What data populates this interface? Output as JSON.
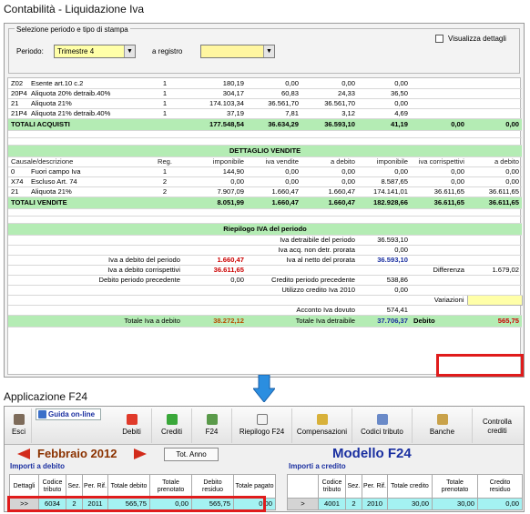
{
  "headings": {
    "top": "Contabilità  - Liquidazione  Iva",
    "bottom": "Applicazione  F24"
  },
  "selection": {
    "legend": "Selezione periodo e tipo di stampa",
    "period_label": "Periodo:",
    "period_value": "Trimestre 4",
    "register_label": "a registro",
    "register_value": "",
    "show_details_label": "Visualizza dettagli"
  },
  "purchases": {
    "rows": [
      [
        "Z02",
        "Esente art.10 c.2",
        "1",
        "180,19",
        "0,00",
        "0,00",
        "0,00"
      ],
      [
        "20P4",
        "Aliquota 20% detraib.40%",
        "1",
        "304,17",
        "60,83",
        "24,33",
        "36,50"
      ],
      [
        "21",
        "Aliquota 21%",
        "1",
        "174.103,34",
        "36.561,70",
        "36.561,70",
        "0,00"
      ],
      [
        "21P4",
        "Aliquota 21% detraib.40%",
        "1",
        "37,19",
        "7,81",
        "3,12",
        "4,69"
      ]
    ],
    "total_label": "TOTALI ACQUISTI",
    "totals": [
      "177.548,54",
      "36.634,29",
      "36.593,10",
      "41,19",
      "0,00",
      "0,00"
    ]
  },
  "sales": {
    "title": "DETTAGLIO VENDITE",
    "columns": [
      "Causale/descrizione",
      "Reg.",
      "imponibile",
      "iva vendite",
      "a debito",
      "imponibile",
      "iva corrispettivi",
      "a debito"
    ],
    "rows": [
      [
        "0",
        "Fuori campo Iva",
        "1",
        "144,90",
        "0,00",
        "0,00",
        "0,00",
        "0,00",
        "0,00"
      ],
      [
        "X74",
        "Escluso Art. 74",
        "2",
        "0,00",
        "0,00",
        "0,00",
        "8.587,65",
        "0,00",
        "0,00"
      ],
      [
        "21",
        "Aliquota 21%",
        "2",
        "7.907,09",
        "1.660,47",
        "1.660,47",
        "174.141,01",
        "36.611,65",
        "36.611,65"
      ]
    ],
    "total_label": "TOTALI VENDITE",
    "totals": [
      "8.051,99",
      "1.660,47",
      "1.660,47",
      "182.928,66",
      "36.611,65",
      "36.611,65"
    ]
  },
  "summary": {
    "title": "Riepilogo IVA del periodo",
    "iva_detraibile_label": "Iva detraibile del periodo",
    "iva_detraibile": "36.593,10",
    "iva_acq_label": "Iva acq. non detr. prorata",
    "iva_acq": "0,00",
    "iva_debito_label": "Iva a debito del periodo",
    "iva_debito": "1.660,47",
    "iva_netto_label": "Iva al netto del prorata",
    "iva_netto": "36.593,10",
    "iva_corr_label": "Iva a debito corrispettivi",
    "iva_corr": "36.611,65",
    "differenza_label": "Differenza",
    "differenza": "1.679,02",
    "debito_prec_label": "Debito periodo precedente",
    "debito_prec": "0,00",
    "credito_prec_label": "Credito periodo precedente",
    "credito_prec": "538,86",
    "utilizzo_label": "Utilizzo credito Iva 2010",
    "utilizzo": "0,00",
    "variazioni_label": "Variazioni",
    "acconto_label": "Acconto Iva dovuto",
    "acconto": "574,41",
    "tot_debito_label": "Totale Iva a debito",
    "tot_debito": "38.272,12",
    "tot_detraibile_label": "Totale Iva detraibile",
    "tot_detraibile": "37.706,37",
    "result_label": "Debito",
    "result_value": "565,75"
  },
  "toolbar": {
    "esci": "Esci",
    "guida": "Guida on-line",
    "debiti": "Debiti",
    "crediti": "Crediti",
    "f24": "F24",
    "riepilogo": "Riepilogo F24",
    "compensazioni": "Compensazioni",
    "codici": "Codici tributo",
    "banche": "Banche",
    "controllo": "Controlla crediti"
  },
  "f24": {
    "month": "Febbraio 2012",
    "tot_anno": "Tot. Anno",
    "model": "Modello F24",
    "debit_section": "Importi a debito",
    "credit_section": "Importi a credito",
    "debit_columns": [
      "Dettagli",
      "Codice tributo",
      "Sez.",
      "Per. Rif.",
      "Totale debito",
      "Totale prenotato",
      "Debito residuo",
      "Totale pagato"
    ],
    "debit_row": [
      ">>",
      "6034",
      "2",
      "2011",
      "565,75",
      "0,00",
      "565,75",
      "0,00"
    ],
    "credit_columns": [
      "",
      "Codice tributo",
      "Sez.",
      "Per. Rif.",
      "Totale credito",
      "Totale prenotato",
      "Credito residuo"
    ],
    "credit_row": [
      ">",
      "4001",
      "2",
      "2010",
      "30,00",
      "30,00",
      "0,00"
    ]
  },
  "colors": {
    "total_green": "#b4ecb4",
    "highlight_red": "#e01c1c",
    "f24_row_cyan": "#a4f2f2",
    "title_blue": "#1a2fa0",
    "month_brown": "#8b3200"
  }
}
